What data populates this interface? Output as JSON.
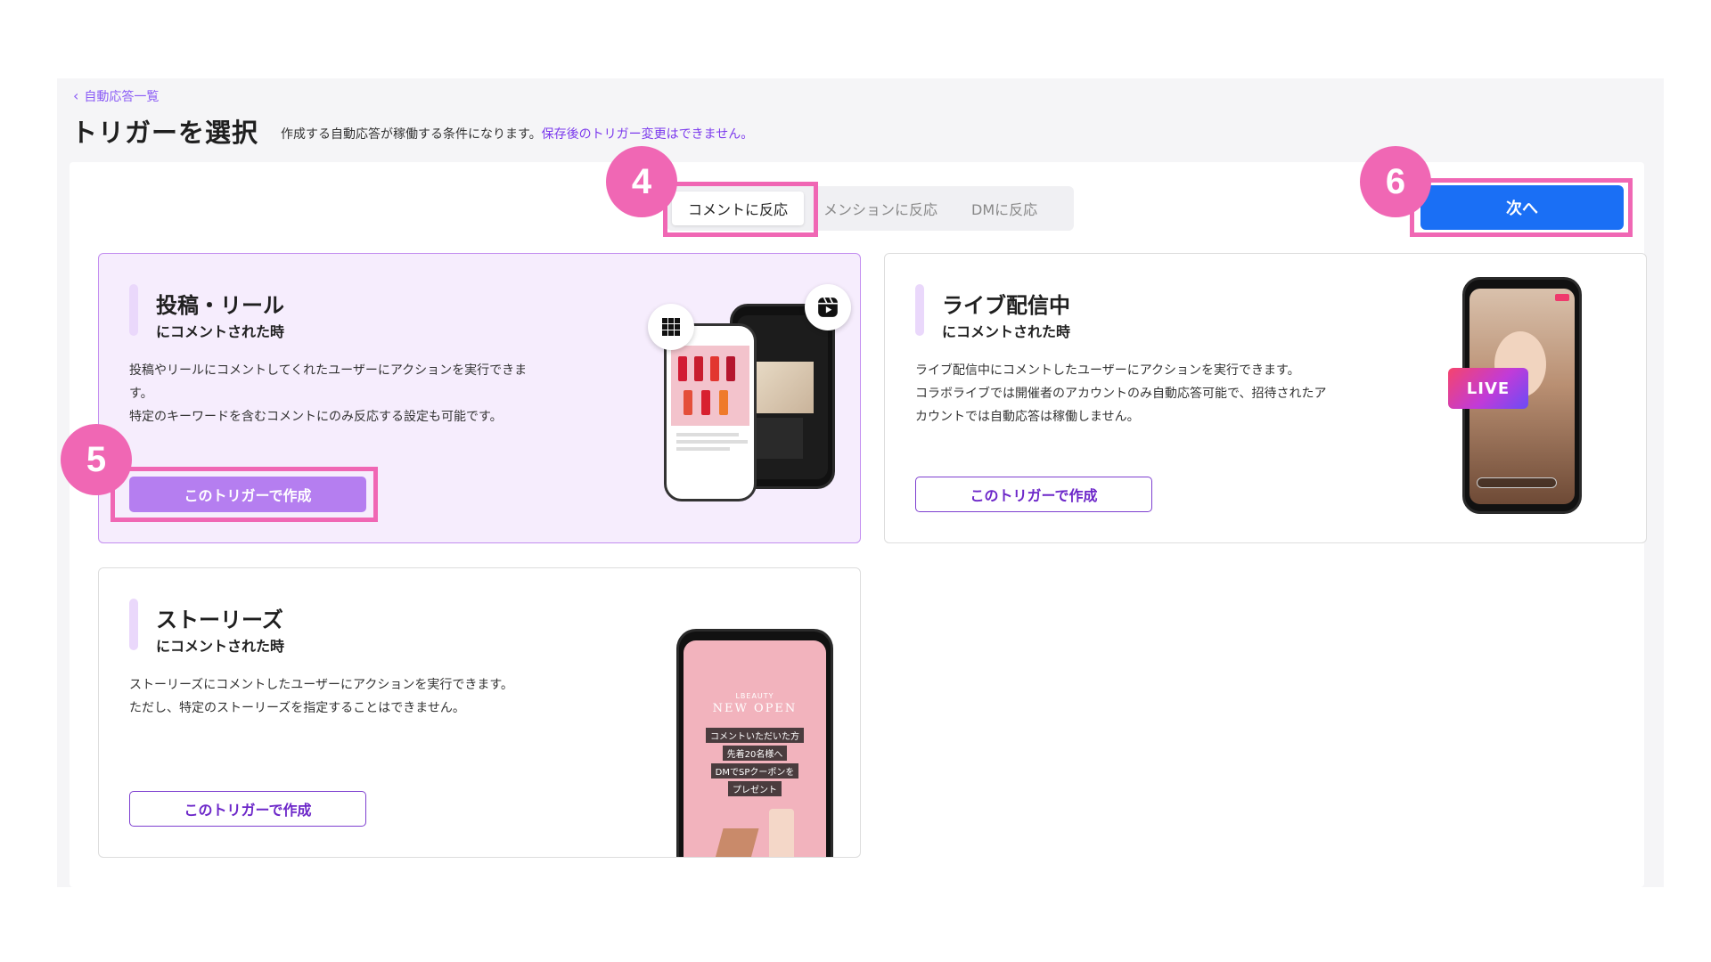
{
  "header": {
    "back_label": "自動応答一覧",
    "title": "トリガーを選択",
    "description": "作成する自動応答が稼働する条件になります。",
    "warning": "保存後のトリガー変更はできません。"
  },
  "tabs": [
    {
      "label": "コメントに反応",
      "active": true
    },
    {
      "label": "メンションに反応",
      "active": false
    },
    {
      "label": "DMに反応",
      "active": false
    }
  ],
  "next_button": "次へ",
  "cards": {
    "post_reel": {
      "title": "投稿・リール",
      "subtitle": "にコメントされた時",
      "desc": [
        "投稿やリールにコメントしてくれたユーザーにアクションを実行できま",
        "す。",
        "特定のキーワードを含むコメントにのみ反応する設定も可能です。"
      ],
      "button": "このトリガーで作成",
      "selected": true
    },
    "live": {
      "title": "ライブ配信中",
      "subtitle": "にコメントされた時",
      "desc": [
        "ライブ配信中にコメントしたユーザーにアクションを実行できます。",
        "コラボライブでは開催者のアカウントのみ自動応答可能で、招待されたア",
        "カウントでは自動応答は稼働しません。"
      ],
      "button": "このトリガーで作成",
      "badge": "LIVE",
      "selected": false
    },
    "stories": {
      "title": "ストーリーズ",
      "subtitle": "にコメントされた時",
      "desc": [
        "ストーリーズにコメントしたユーザーにアクションを実行できます。",
        "ただし、特定のストーリーズを指定することはできません。"
      ],
      "button": "このトリガーで作成",
      "story_brand": "LBEAUTY",
      "story_headline": "NEW OPEN",
      "story_lines": [
        "コメントいただいた方",
        "先着20名様へ",
        "DMでSPクーポンを",
        "プレゼント"
      ],
      "selected": false
    }
  },
  "annotations": {
    "step4": "4",
    "step5": "5",
    "step6": "6",
    "color": "#f067b4"
  },
  "colors": {
    "primary_blue": "#1a6ff5",
    "accent_purple": "#7e3fd0",
    "selected_bg": "#f6edfd"
  }
}
